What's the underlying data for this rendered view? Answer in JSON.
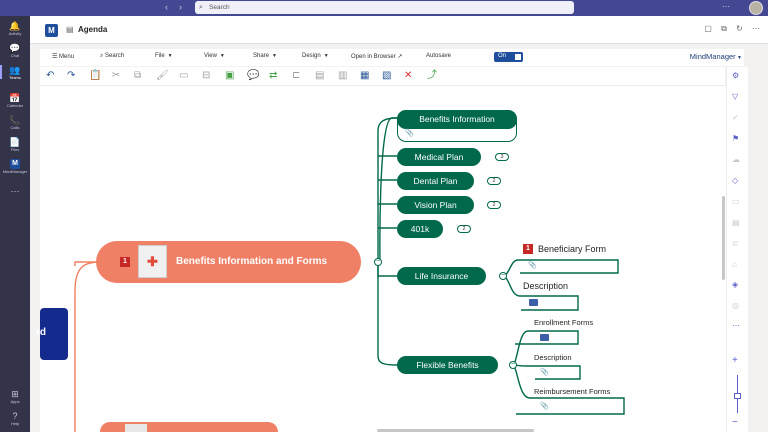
{
  "teams": {
    "search_placeholder": "Search",
    "rail": [
      {
        "icon": "activity-icon",
        "glyph": "🔔",
        "label": "Activity"
      },
      {
        "icon": "chat-icon",
        "glyph": "💬",
        "label": "Chat"
      },
      {
        "icon": "teams-icon",
        "glyph": "👥",
        "label": "Teams"
      },
      {
        "icon": "calendar-icon",
        "glyph": "📅",
        "label": "Calendar"
      },
      {
        "icon": "calls-icon",
        "glyph": "📞",
        "label": "Calls"
      },
      {
        "icon": "files-icon",
        "glyph": "📄",
        "label": "Files"
      },
      {
        "icon": "mindmanager-icon",
        "glyph": "M",
        "label": "MindManager"
      },
      {
        "icon": "more-apps-icon",
        "glyph": "⋯",
        "label": ""
      },
      {
        "icon": "apps-icon",
        "glyph": "⊞",
        "label": "Apps"
      },
      {
        "icon": "help-icon",
        "glyph": "?",
        "label": "Help"
      }
    ]
  },
  "app": {
    "title": "Agenda",
    "brand": "MindManager",
    "menu": {
      "menu": "Menu",
      "search": "Search",
      "file": "File",
      "view": "View",
      "share": "Share",
      "design": "Design",
      "open_in_browser": "Open in Browser",
      "autosave": "Autosave",
      "autosave_state": "On"
    }
  },
  "map": {
    "central": {
      "text": "Benefits Information and Forms",
      "priority": "1"
    },
    "root_fragment": "rd",
    "branches": [
      {
        "text": "Benefits Information",
        "badge": ""
      },
      {
        "text": "Medical Plan",
        "badge": "3"
      },
      {
        "text": "Dental Plan",
        "badge": "2"
      },
      {
        "text": "Vision Plan",
        "badge": "2"
      },
      {
        "text": "401k",
        "badge": "2"
      },
      {
        "text": "Life Insurance",
        "badge": ""
      },
      {
        "text": "Flexible Benefits",
        "badge": ""
      }
    ],
    "life_insurance_children": [
      {
        "text": "Beneficiary Form",
        "priority": "1"
      },
      {
        "text": "Description",
        "priority": ""
      }
    ],
    "flexible_children": [
      {
        "text": "Enrollment Forms"
      },
      {
        "text": "Description"
      },
      {
        "text": "Reimbursement Forms"
      }
    ]
  }
}
